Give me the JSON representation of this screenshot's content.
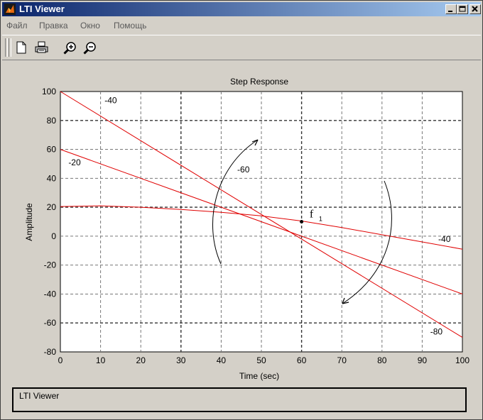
{
  "window": {
    "title": "LTI Viewer"
  },
  "menu": [
    "Файл",
    "Правка",
    "Окно",
    "Помощь"
  ],
  "toolbar": {
    "buttons": [
      "new-file-icon",
      "print-icon",
      "zoom-in-icon",
      "zoom-out-icon"
    ]
  },
  "chart_data": {
    "type": "line",
    "title": "Step Response",
    "xlabel": "Time (sec)",
    "ylabel": "Amplitude",
    "xlim": [
      0,
      100
    ],
    "ylim": [
      -80,
      100
    ],
    "grid": true,
    "x_ticks": [
      "0",
      "10",
      "20",
      "30",
      "40",
      "50",
      "60",
      "70",
      "80",
      "90",
      "100"
    ],
    "y_ticks": [
      "100",
      "80",
      "60",
      "40",
      "20",
      "0",
      "-20",
      "-40",
      "-60",
      "-80"
    ],
    "series": [
      {
        "x": [
          0,
          100
        ],
        "values": [
          100,
          -70
        ],
        "color": "#e00000"
      },
      {
        "x": [
          0,
          100
        ],
        "values": [
          60,
          -40
        ],
        "color": "#e00000"
      },
      {
        "x": [
          0,
          10,
          20,
          30,
          40,
          50,
          60,
          70,
          80,
          90,
          100
        ],
        "values": [
          20.5,
          21,
          20,
          18.5,
          16.5,
          14,
          10.5,
          6,
          1,
          -4,
          -9
        ],
        "color": "#e00000"
      }
    ],
    "intersection_point": {
      "x": 60,
      "y": 10
    },
    "annotations": [
      {
        "text": "-40",
        "x": 11,
        "y": 92
      },
      {
        "text": "-20",
        "x": 2,
        "y": 49
      },
      {
        "text": "-60",
        "x": 44,
        "y": 44
      },
      {
        "text": "-40",
        "x": 94,
        "y": -4
      },
      {
        "text": "-80",
        "x": 92,
        "y": -68
      }
    ],
    "pole_label": {
      "text": "f",
      "subscript": "1",
      "x": 62,
      "y": 13
    }
  },
  "status": {
    "text": "LTI Viewer"
  },
  "colors": {
    "title_bar_start": "#0a246a",
    "title_bar_end": "#a6caf0",
    "curve": "#e00000",
    "background": "#d4d0c8",
    "axes_bg": "#ffffff"
  }
}
